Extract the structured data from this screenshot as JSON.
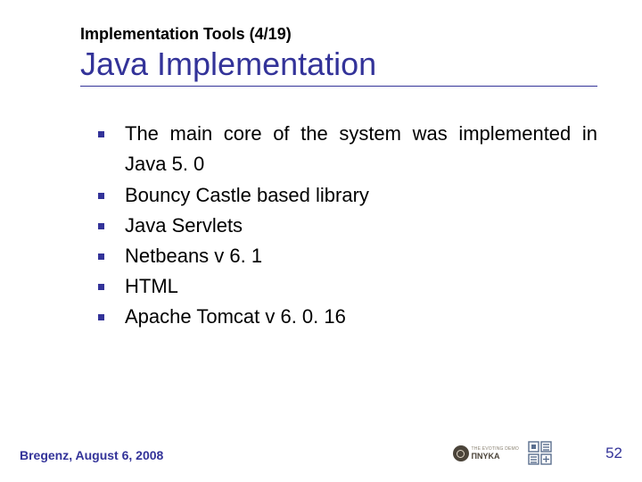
{
  "breadcrumb": "Implementation Tools (4/19)",
  "title": "Java Implementation",
  "bullets": [
    "The main core of the system was implemented in Java 5. 0",
    "Bouncy Castle based library",
    "Java Servlets",
    "Netbeans v 6. 1",
    "HTML",
    "Apache Tomcat v 6. 0. 16"
  ],
  "footer_location": "Bregenz, August 6, 2008",
  "page_number": "52",
  "logo1_text": "ΠΝΥΚΑ",
  "logo1_sub": "THE EVOTING DEMO"
}
